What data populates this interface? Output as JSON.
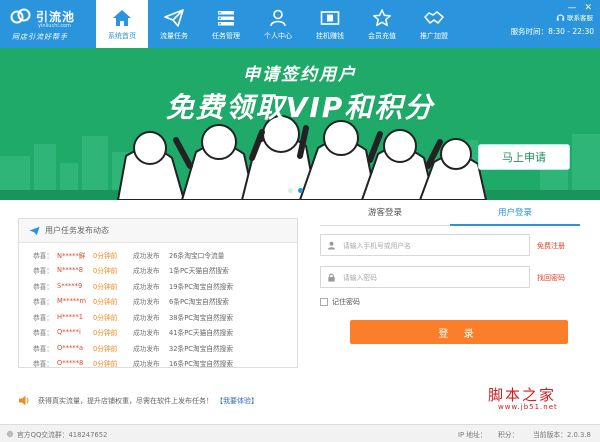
{
  "header": {
    "logo_name": "引流池",
    "logo_domain": "yinliuchi.com",
    "slogan": "网店引流好帮手",
    "nav": [
      {
        "label": "系统首页",
        "icon": "home-icon",
        "active": true
      },
      {
        "label": "流量任务",
        "icon": "paper-plane-icon",
        "active": false
      },
      {
        "label": "任务管理",
        "icon": "list-manage-icon",
        "active": false
      },
      {
        "label": "个人中心",
        "icon": "user-icon",
        "active": false
      },
      {
        "label": "挂机赚钱",
        "icon": "money-icon",
        "active": false
      },
      {
        "label": "会员充值",
        "icon": "star-icon",
        "active": false
      },
      {
        "label": "推广加盟",
        "icon": "handshake-icon",
        "active": false
      }
    ],
    "kefu_label": "联系客服",
    "service_label": "服务时间：",
    "service_time": "8:30 - 22:30"
  },
  "banner": {
    "title1": "申请签约用户",
    "title2": "免费领取VIP和积分",
    "apply_label": "马上申请",
    "slide_count": 2,
    "active_slide": 1
  },
  "tasks": {
    "title": "用户任务发布动态",
    "rows": [
      {
        "congrats": "恭喜：",
        "user": "N*****鲜",
        "time": "0分钟前",
        "status": "成功发布",
        "detail": "26条淘宝口令流量"
      },
      {
        "congrats": "恭喜：",
        "user": "N*****8",
        "time": "0分钟前",
        "status": "成功发布",
        "detail": "1条PC天猫自然搜索"
      },
      {
        "congrats": "恭喜：",
        "user": "S*****9",
        "time": "0分钟前",
        "status": "成功发布",
        "detail": "19条PC淘宝自然搜索"
      },
      {
        "congrats": "恭喜：",
        "user": "M*****m",
        "time": "0分钟前",
        "status": "成功发布",
        "detail": "6条PC淘宝自然搜索"
      },
      {
        "congrats": "恭喜：",
        "user": "H*****1",
        "time": "0分钟前",
        "status": "成功发布",
        "detail": "38条PC淘宝自然搜索"
      },
      {
        "congrats": "恭喜：",
        "user": "Q*****i",
        "time": "0分钟前",
        "status": "成功发布",
        "detail": "41条PC天猫自然搜索"
      },
      {
        "congrats": "恭喜：",
        "user": "O*****a",
        "time": "0分钟前",
        "status": "成功发布",
        "detail": "32条PC淘宝自然搜索"
      },
      {
        "congrats": "恭喜：",
        "user": "O*****8",
        "time": "0分钟前",
        "status": "成功发布",
        "detail": "16条PC淘宝自然搜索"
      }
    ]
  },
  "notice": {
    "text": "获得真实流量，提升店铺权重，尽需在软件上发布任务！",
    "link": "【我要体验】"
  },
  "login": {
    "tab_guest": "游客登录",
    "tab_user": "用户登录",
    "phone_placeholder": "请输入手机号或用户名",
    "register_link": "免费注册",
    "password_placeholder": "请输入密码",
    "forgot_link": "找回密码",
    "remember_label": "记住密码",
    "login_label": "登  录"
  },
  "watermark": {
    "text1": "脚本之家",
    "text2": "www.jb51.net"
  },
  "statusbar": {
    "qq_group": "官方QQ交流群：418247652",
    "ip_label": "IP 地址：",
    "points_label": "积分：",
    "version_label": "当前版本：2.0.3.8"
  },
  "colors": {
    "primary": "#2a95dd",
    "banner": "#1faa6a",
    "accent": "#fb7f2a",
    "alert": "#e0442a"
  }
}
